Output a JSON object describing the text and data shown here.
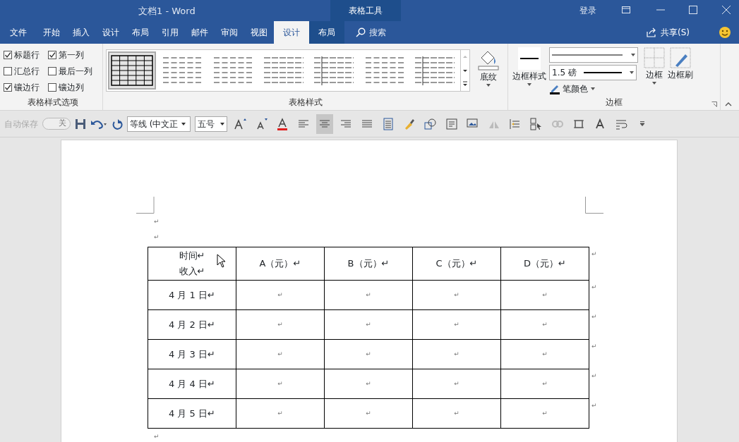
{
  "title_bar": {
    "doc_title": "文档1  -  Word",
    "context_title": "表格工具",
    "sign_in": "登录"
  },
  "menu_tabs": [
    {
      "label": "文件",
      "kind": "file",
      "selected": false
    },
    {
      "label": "开始",
      "kind": "normal",
      "selected": false
    },
    {
      "label": "插入",
      "kind": "normal",
      "selected": false
    },
    {
      "label": "设计",
      "kind": "normal",
      "selected": false
    },
    {
      "label": "布局",
      "kind": "normal",
      "selected": false
    },
    {
      "label": "引用",
      "kind": "normal",
      "selected": false
    },
    {
      "label": "邮件",
      "kind": "normal",
      "selected": false
    },
    {
      "label": "审阅",
      "kind": "normal",
      "selected": false
    },
    {
      "label": "视图",
      "kind": "normal",
      "selected": false
    },
    {
      "label": "设计",
      "kind": "context",
      "selected": true
    },
    {
      "label": "布局",
      "kind": "context",
      "selected": false
    }
  ],
  "search": {
    "label": "搜索"
  },
  "share": {
    "label": "共享(S)"
  },
  "ribbon": {
    "style_options": {
      "label": "表格样式选项",
      "options": [
        {
          "label": "标题行",
          "checked": true
        },
        {
          "label": "第一列",
          "checked": true
        },
        {
          "label": "汇总行",
          "checked": false
        },
        {
          "label": "最后一列",
          "checked": false
        },
        {
          "label": "镶边行",
          "checked": true
        },
        {
          "label": "镶边列",
          "checked": false
        }
      ]
    },
    "table_styles": {
      "label": "表格样式",
      "styles": [
        {
          "kind": "grid",
          "selected": true
        },
        {
          "kind": "dash",
          "selected": false
        },
        {
          "kind": "dash",
          "selected": false
        },
        {
          "kind": "lines",
          "selected": false
        },
        {
          "kind": "cols",
          "selected": false
        },
        {
          "kind": "dash",
          "selected": false
        },
        {
          "kind": "cols",
          "selected": false
        }
      ]
    },
    "shading": {
      "label": "底纹"
    },
    "borders": {
      "label": "边框",
      "border_styles": "边框样式",
      "weight": "1.5 磅",
      "pen_color": "笔颜色",
      "border": "边框",
      "border_painter": "边框刷"
    }
  },
  "quick_access": {
    "autosave": "自动保存",
    "autosave_on": false,
    "autosave_state": "关",
    "font": "等线 (中文正",
    "size": "五号",
    "tools": [
      {
        "kind": "grow-font",
        "selected": false
      },
      {
        "kind": "shrink-font",
        "selected": false
      },
      {
        "kind": "font-color",
        "selected": false
      },
      {
        "kind": "align-left",
        "selected": false
      },
      {
        "kind": "align-center",
        "selected": true
      },
      {
        "kind": "align-right",
        "selected": false
      },
      {
        "kind": "justify",
        "selected": false
      },
      {
        "kind": "distribute",
        "selected": false
      },
      {
        "kind": "brush",
        "selected": false
      },
      {
        "kind": "shapes",
        "selected": false
      },
      {
        "kind": "textbox",
        "selected": false
      },
      {
        "kind": "picture",
        "selected": false
      },
      {
        "kind": "flip",
        "selected": false
      },
      {
        "kind": "indent",
        "selected": false
      },
      {
        "kind": "select",
        "selected": false
      },
      {
        "kind": "link",
        "selected": false
      },
      {
        "kind": "crop",
        "selected": false
      },
      {
        "kind": "text",
        "selected": false
      },
      {
        "kind": "wrap",
        "selected": false
      },
      {
        "kind": "more",
        "selected": false
      }
    ]
  },
  "document": {
    "paragraphs_before": [
      "↵",
      "↵"
    ],
    "table": {
      "header_corner": [
        "时间↵",
        "收入↵"
      ],
      "columns": [
        "A（元）↵",
        "B（元）↵",
        "C（元）↵",
        "D（元）↵"
      ],
      "header_end": "↵",
      "rows": [
        {
          "label": "4 月 1 日↵",
          "cells": [
            "↵",
            "↵",
            "↵",
            "↵"
          ],
          "end": "↵"
        },
        {
          "label": "4 月 2 日↵",
          "cells": [
            "↵",
            "↵",
            "↵",
            "↵"
          ],
          "end": "↵"
        },
        {
          "label": "4 月 3 日↵",
          "cells": [
            "↵",
            "↵",
            "↵",
            "↵"
          ],
          "end": "↵"
        },
        {
          "label": "4 月 4 日↵",
          "cells": [
            "↵",
            "↵",
            "↵",
            "↵"
          ],
          "end": "↵"
        },
        {
          "label": "4 月 5 日↵",
          "cells": [
            "↵",
            "↵",
            "↵",
            "↵"
          ],
          "end": "↵"
        }
      ]
    },
    "paragraph_after": "↵"
  }
}
